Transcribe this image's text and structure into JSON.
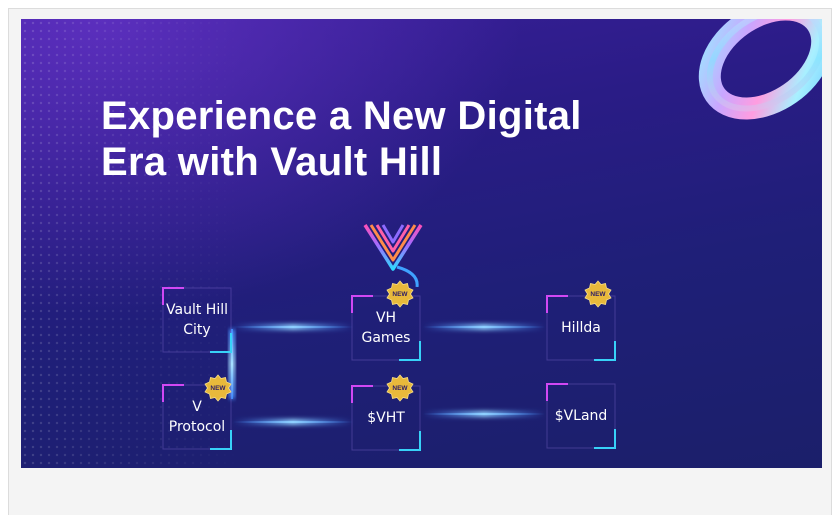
{
  "banner": {
    "headline_line1": "Experience a New Digital",
    "headline_line2": "Era with Vault Hill"
  },
  "nodes": [
    {
      "line1": "Vault Hill",
      "line2": "City"
    },
    {
      "line1": "VH",
      "line2": "Games",
      "badge": "NEW"
    },
    {
      "line1": "Hillda",
      "badge": "NEW"
    },
    {
      "line1": "V",
      "line2": "Protocol",
      "badge": "NEW"
    },
    {
      "line1": "$VHT",
      "badge": "NEW"
    },
    {
      "line1": "$VLand"
    }
  ],
  "icons": {
    "logo": "vault-hill-logo",
    "ring": "holographic-ring",
    "badge": "new-badge-icon"
  },
  "colors": {
    "bg_top": "#3a1f9a",
    "bg_bottom": "#1b1f6a",
    "frame_magenta": "#e040fb",
    "frame_cyan": "#27e6ff",
    "link_blue": "#3f8cff",
    "badge_gold": "#e8b93b"
  }
}
